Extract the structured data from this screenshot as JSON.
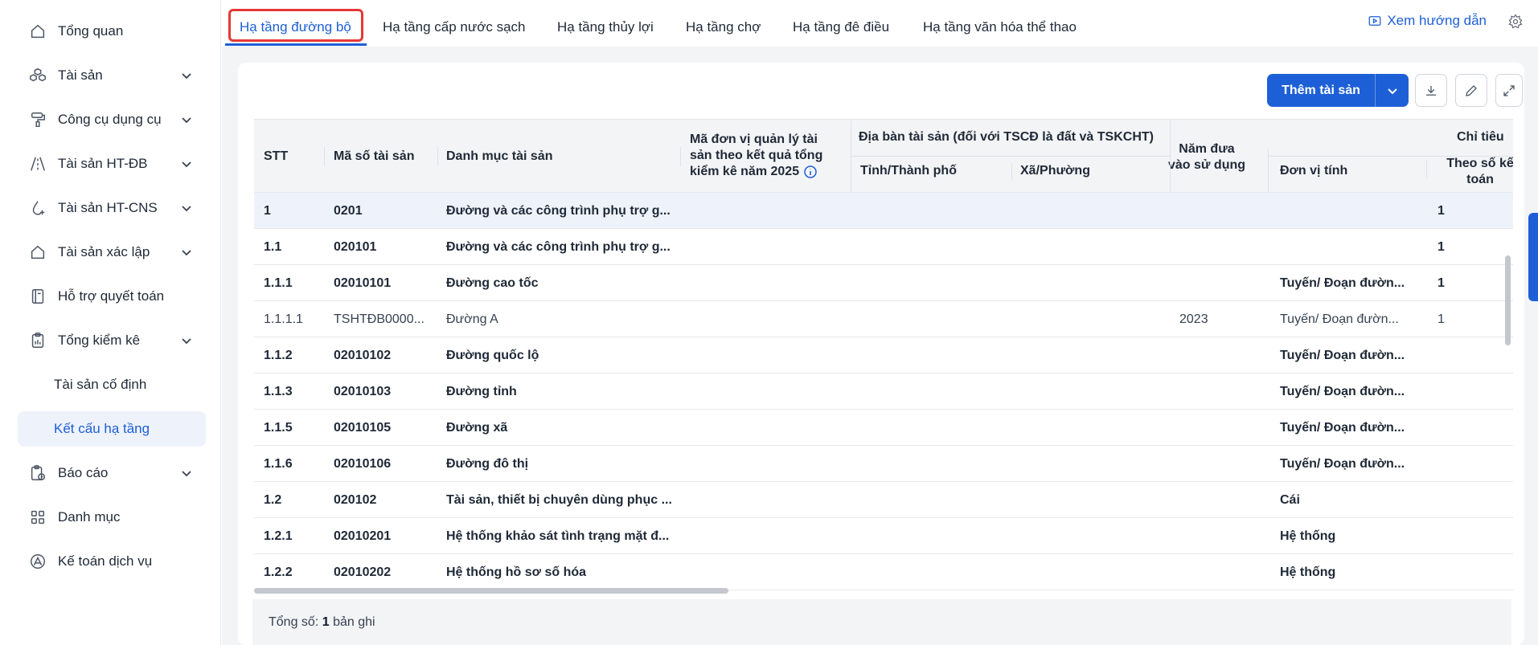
{
  "sidebar": {
    "items": [
      {
        "label": "Tổng quan",
        "icon": "home-icon"
      },
      {
        "label": "Tài sản",
        "icon": "cubes-icon"
      },
      {
        "label": "Công cụ dụng cụ",
        "icon": "paint-roller-icon"
      },
      {
        "label": "Tài sản HT-ĐB",
        "icon": "road-icon"
      },
      {
        "label": "Tài sản HT-CNS",
        "icon": "water-drop-icon"
      },
      {
        "label": "Tài sản xác lập",
        "icon": "home-icon"
      },
      {
        "label": "Hỗ trợ quyết toán",
        "icon": "notebook-icon"
      },
      {
        "label": "Tổng kiểm kê",
        "icon": "clipboard-icon"
      },
      {
        "label": "Tài sản cố định"
      },
      {
        "label": "Kết cấu hạ tầng"
      },
      {
        "label": "Báo cáo",
        "icon": "report-clock-icon"
      },
      {
        "label": "Danh mục",
        "icon": "grid-icon"
      },
      {
        "label": "Kế toán dịch vụ",
        "icon": "accounting-icon"
      }
    ]
  },
  "tabs": [
    "Hạ tầng đường bộ",
    "Hạ tầng cấp nước sạch",
    "Hạ tầng thủy lợi",
    "Hạ tầng chợ",
    "Hạ tầng đê điều",
    "Hạ tầng văn hóa thể thao"
  ],
  "header": {
    "guide_label": "Xem hướng dẫn"
  },
  "toolbar": {
    "add_label": "Thêm tài sản"
  },
  "table": {
    "columns": {
      "stt": "STT",
      "code": "Mã số tài sản",
      "category": "Danh mục tài sản",
      "unit_code_l1": "Mã đơn vị quản lý tài",
      "unit_code_l2": "sản theo kết quả tổng",
      "unit_code_l3": "kiểm kê năm 2025",
      "location_group": "Địa bàn tài sản (đối với TSCĐ là đất và TSKCHT)",
      "province": "Tỉnh/Thành phố",
      "ward": "Xã/Phường",
      "year_l1": "Năm đưa",
      "year_l2": "vào sử dụng",
      "indicator_group": "Chỉ tiêu",
      "unit": "Đơn vị tính",
      "book_l1": "Theo số kế",
      "book_l2": "toán"
    },
    "rows": [
      {
        "stt": "1",
        "code": "0201",
        "category": "Đường và các công trình phụ trợ g...",
        "year": "",
        "unit": "",
        "book": "1",
        "bold": true
      },
      {
        "stt": "1.1",
        "code": "020101",
        "category": "Đường và các công trình phụ trợ g...",
        "year": "",
        "unit": "",
        "book": "1",
        "bold": true
      },
      {
        "stt": "1.1.1",
        "code": "02010101",
        "category": "Đường cao tốc",
        "year": "",
        "unit": "Tuyến/ Đoạn đườn...",
        "book": "1",
        "bold": true
      },
      {
        "stt": "1.1.1.1",
        "code": "TSHTĐB0000...",
        "category": "Đường A",
        "year": "2023",
        "unit": "Tuyến/ Đoạn đườn...",
        "book": "1",
        "bold": false
      },
      {
        "stt": "1.1.2",
        "code": "02010102",
        "category": "Đường quốc lộ",
        "year": "",
        "unit": "Tuyến/ Đoạn đườn...",
        "book": "",
        "bold": true
      },
      {
        "stt": "1.1.3",
        "code": "02010103",
        "category": "Đường tỉnh",
        "year": "",
        "unit": "Tuyến/ Đoạn đườn...",
        "book": "",
        "bold": true
      },
      {
        "stt": "1.1.5",
        "code": "02010105",
        "category": "Đường xã",
        "year": "",
        "unit": "Tuyến/ Đoạn đườn...",
        "book": "",
        "bold": true
      },
      {
        "stt": "1.1.6",
        "code": "02010106",
        "category": "Đường đô thị",
        "year": "",
        "unit": "Tuyến/ Đoạn đườn...",
        "book": "",
        "bold": true
      },
      {
        "stt": "1.2",
        "code": "020102",
        "category": "Tài sản, thiết bị chuyên dùng phục ...",
        "year": "",
        "unit": "Cái",
        "book": "",
        "bold": true
      },
      {
        "stt": "1.2.1",
        "code": "02010201",
        "category": "Hệ thống khảo sát tình trạng mặt đ...",
        "year": "",
        "unit": "Hệ thống",
        "book": "",
        "bold": true
      },
      {
        "stt": "1.2.2",
        "code": "02010202",
        "category": "Hệ thống hồ sơ số hóa",
        "year": "",
        "unit": "Hệ thống",
        "book": "",
        "bold": true
      }
    ]
  },
  "footer": {
    "total_prefix": "Tổng số:",
    "total_count": "1",
    "total_suffix": "bản ghi"
  },
  "colors": {
    "accent": "#1d5fd6",
    "highlight": "#e53935"
  }
}
